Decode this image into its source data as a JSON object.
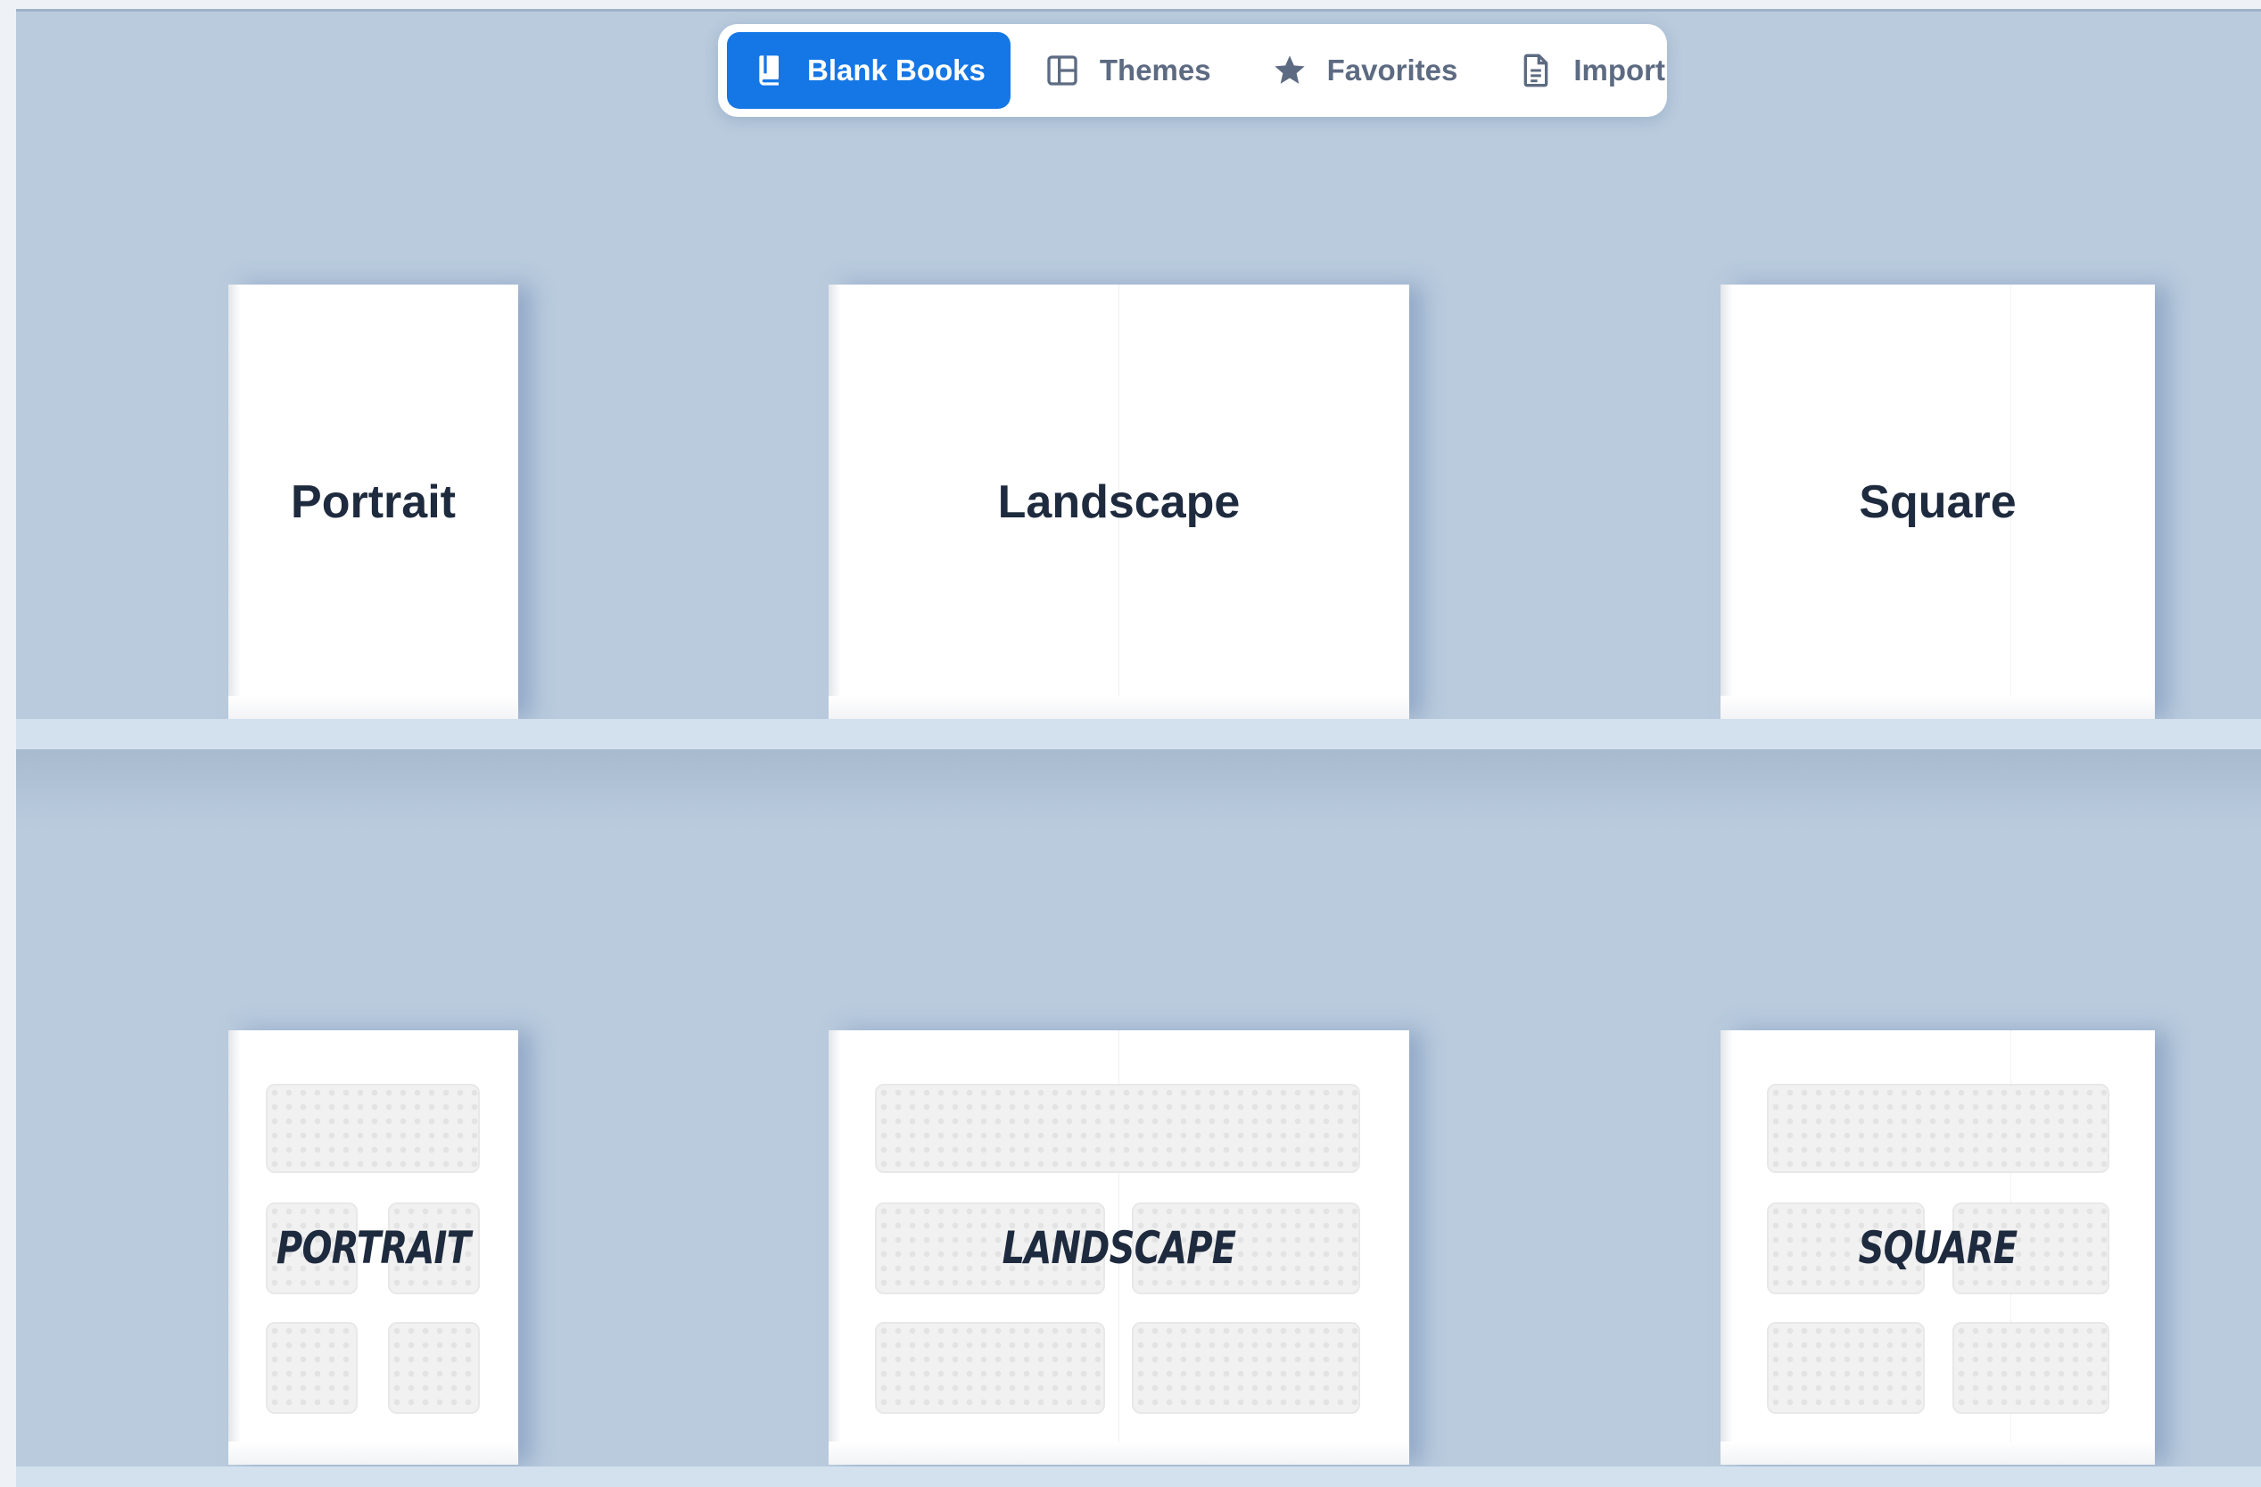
{
  "toolbar": {
    "tabs": [
      {
        "label": "Blank Books",
        "icon": "book-icon",
        "active": true
      },
      {
        "label": "Themes",
        "icon": "layout-icon",
        "active": false
      },
      {
        "label": "Favorites",
        "icon": "star-icon",
        "active": false
      },
      {
        "label": "Import",
        "icon": "file-icon",
        "active": false
      }
    ]
  },
  "shelves": {
    "blank": {
      "books": [
        {
          "label": "Portrait"
        },
        {
          "label": "Landscape"
        },
        {
          "label": "Square"
        }
      ]
    },
    "layout": {
      "books": [
        {
          "label": "PORTRAIT"
        },
        {
          "label": "LANDSCAPE"
        },
        {
          "label": "SQUARE"
        }
      ]
    }
  },
  "colors": {
    "background": "#b9cbdd",
    "accent": "#1577e6",
    "tab_text": "#5d6b82",
    "title_text": "#1e2a3e"
  }
}
